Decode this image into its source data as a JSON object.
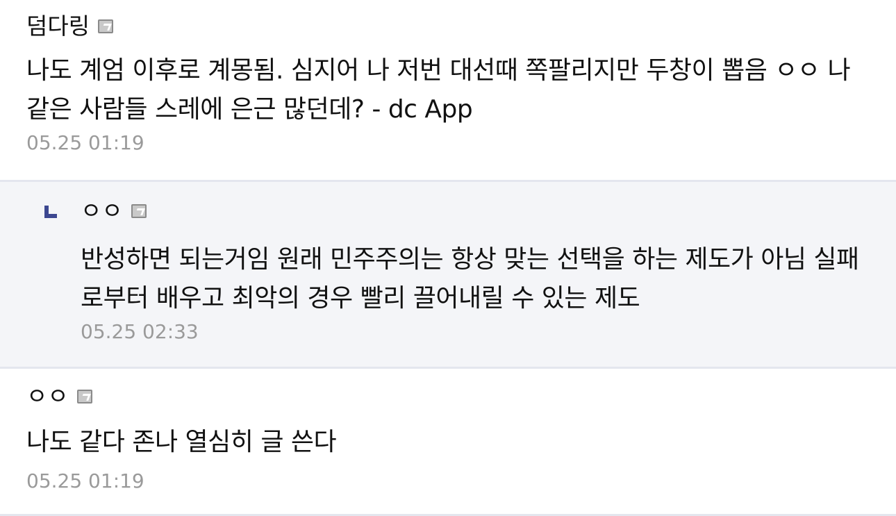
{
  "comments": [
    {
      "nickname": "덤다링",
      "badge_icon": "gallery-member-icon",
      "text": "나도 계엄 이후로 계몽됨. 심지어 나 저번 대선때 쪽팔리지만 두창이 뽑음 ㅇㅇ 나 같은 사람들 스레에 은근 많던데? - dc App",
      "time": "05.25 01:19"
    },
    {
      "is_reply": true,
      "nickname": "ㅇㅇ",
      "badge_icon": "gallery-member-icon",
      "text": "반성하면 되는거임 원래 민주주의는 항상 맞는 선택을 하는 제도가 아님 실패로부터 배우고 최악의 경우 빨리 끌어내릴 수 있는 제도",
      "time": "05.25 02:33"
    },
    {
      "nickname": "ㅇㅇ",
      "badge_icon": "gallery-member-icon",
      "text": "나도 같다 존나 열심히 글 쓴다",
      "time": "05.25 01:19"
    }
  ],
  "colors": {
    "reply_background": "#f4f5f8",
    "reply_arrow": "#3c4790",
    "divider": "#e4e6ee",
    "timestamp": "#9a9a9a"
  }
}
